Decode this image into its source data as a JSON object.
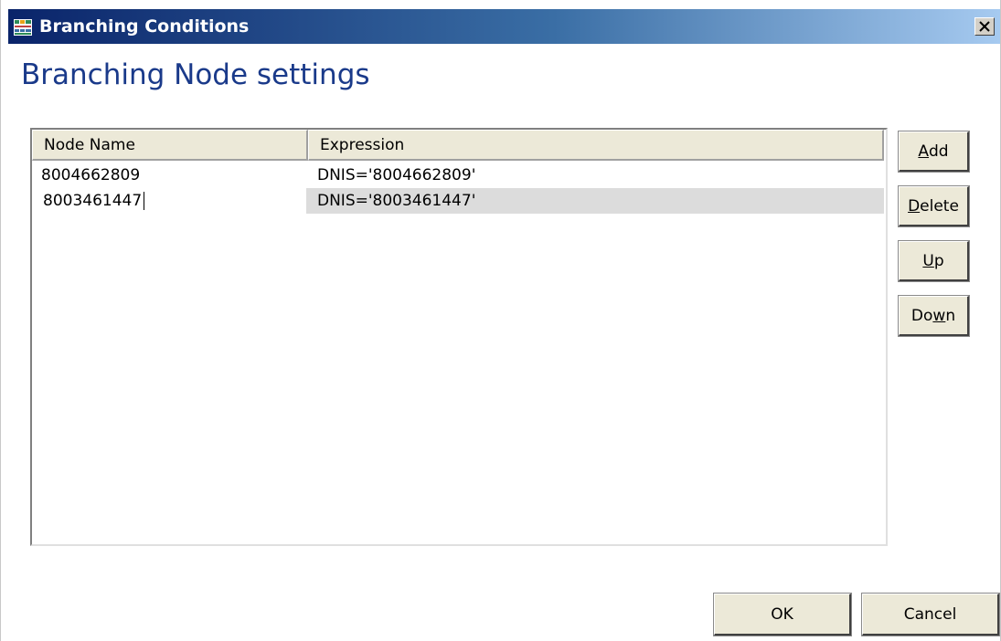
{
  "window": {
    "title": "Branching Conditions",
    "close_label": "×"
  },
  "heading": "Branching Node settings",
  "table": {
    "columns": [
      "Node Name",
      "Expression"
    ],
    "rows": [
      {
        "name": "8004662809",
        "expression": "DNIS='8004662809'"
      },
      {
        "name": "8003461447",
        "expression": "DNIS='8003461447'"
      }
    ],
    "selected_row": 1
  },
  "buttons": {
    "add": {
      "prefix": "",
      "mnemonic": "A",
      "suffix": "dd"
    },
    "delete": {
      "prefix": "",
      "mnemonic": "D",
      "suffix": "elete"
    },
    "up": {
      "prefix": "",
      "mnemonic": "U",
      "suffix": "p"
    },
    "down": {
      "prefix": "Do",
      "mnemonic": "w",
      "suffix": "n"
    },
    "ok": "OK",
    "cancel": "Cancel"
  },
  "icons": {
    "app": "grid-app-icon",
    "close": "close-icon"
  }
}
